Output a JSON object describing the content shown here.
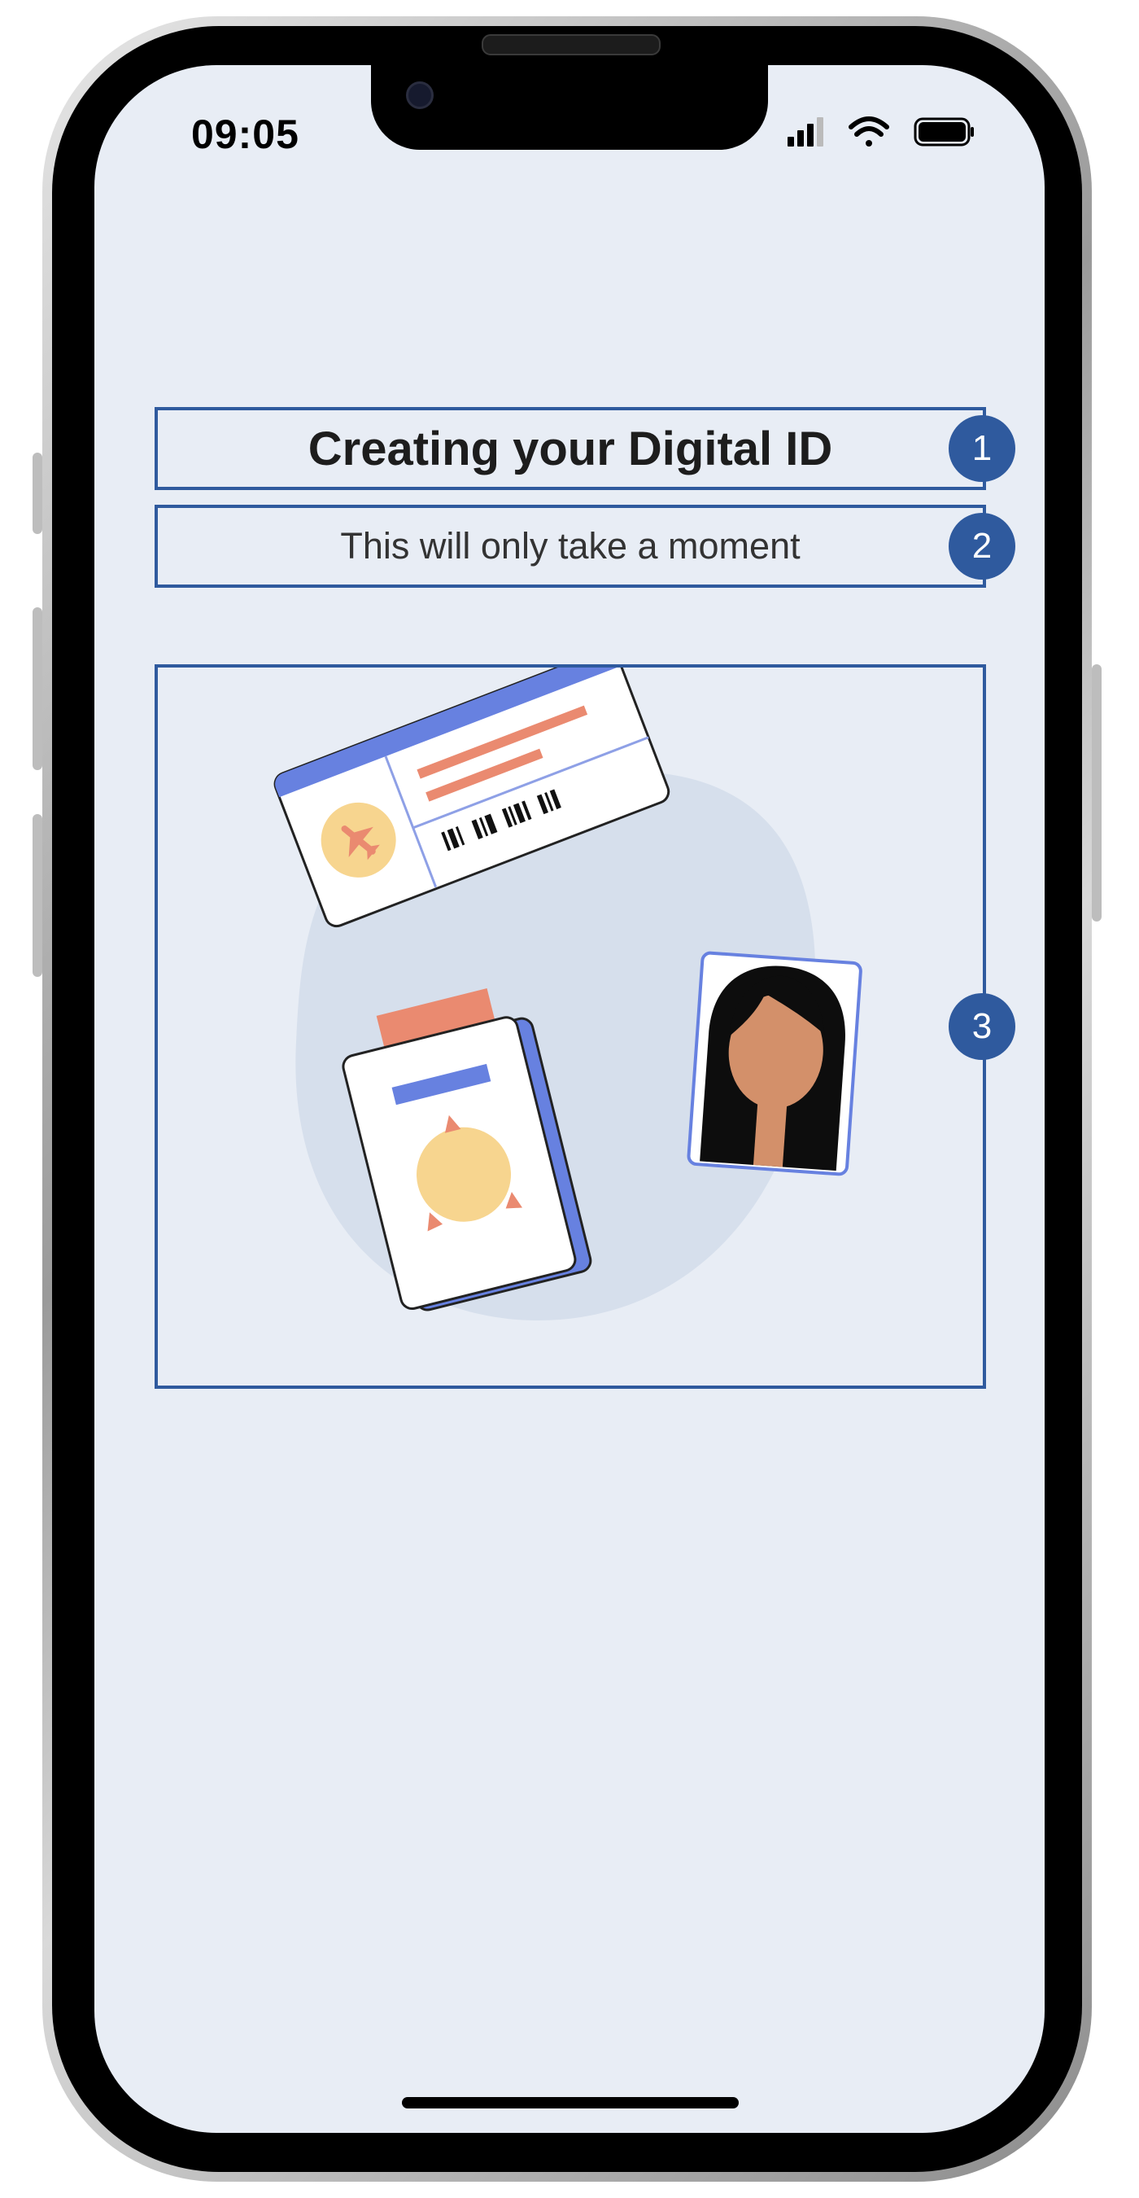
{
  "status_bar": {
    "time": "09:05",
    "icons": [
      "signal-icon",
      "wifi-icon",
      "battery-icon"
    ]
  },
  "main": {
    "title": "Creating your Digital ID",
    "subtitle": "This will only take a moment"
  },
  "markers": [
    "1",
    "2",
    "3"
  ],
  "colors": {
    "screen_bg": "#e8edf5",
    "annotation": "#2f5a9e",
    "card_header": "#6781e0",
    "accent_orange": "#ea8a70",
    "accent_yellow": "#f7d58f",
    "blob": "#d6dfec"
  }
}
